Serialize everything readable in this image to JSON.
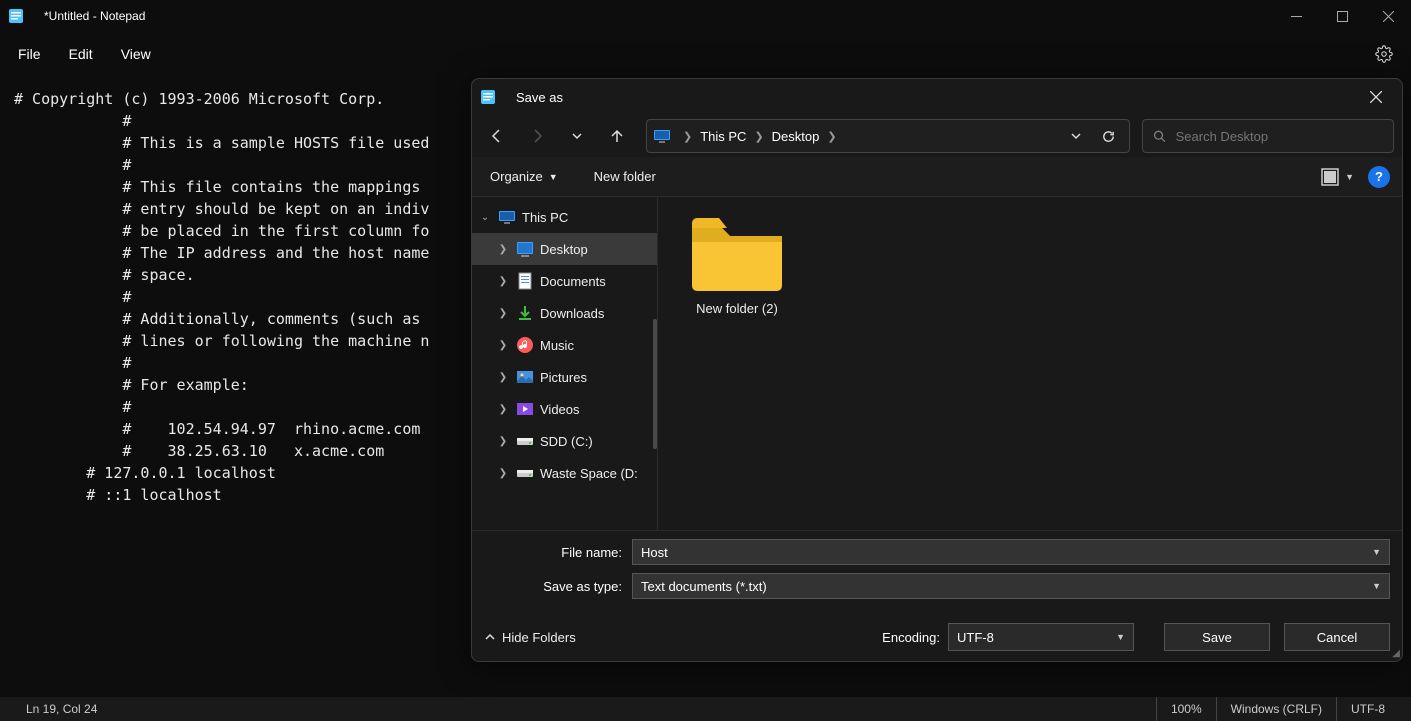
{
  "window": {
    "title": "*Untitled - Notepad"
  },
  "menu": {
    "file": "File",
    "edit": "Edit",
    "view": "View"
  },
  "editor_text": "# Copyright (c) 1993-2006 Microsoft Corp.\n            #\n            # This is a sample HOSTS file used\n            #\n            # This file contains the mappings \n            # entry should be kept on an indiv\n            # be placed in the first column fo\n            # The IP address and the host name\n            # space.\n            #\n            # Additionally, comments (such as \n            # lines or following the machine n\n            #\n            # For example:\n            #\n            #    102.54.94.97  rhino.acme.com \n            #    38.25.63.10   x.acme.com     \n        # 127.0.0.1 localhost\n        # ::1 localhost",
  "status": {
    "pos": "Ln 19, Col 24",
    "zoom": "100%",
    "eol": "Windows (CRLF)",
    "encoding": "UTF-8"
  },
  "dialog": {
    "title": "Save as",
    "path": {
      "root": "This PC",
      "current": "Desktop"
    },
    "search_placeholder": "Search Desktop",
    "toolbar": {
      "organize": "Organize",
      "new_folder": "New folder"
    },
    "tree": [
      {
        "label": "This PC",
        "indent": 0,
        "expanded": true,
        "icon": "pc"
      },
      {
        "label": "Desktop",
        "indent": 1,
        "selected": true,
        "icon": "desktop"
      },
      {
        "label": "Documents",
        "indent": 1,
        "icon": "doc"
      },
      {
        "label": "Downloads",
        "indent": 1,
        "icon": "download"
      },
      {
        "label": "Music",
        "indent": 1,
        "icon": "music"
      },
      {
        "label": "Pictures",
        "indent": 1,
        "icon": "pictures"
      },
      {
        "label": "Videos",
        "indent": 1,
        "icon": "videos"
      },
      {
        "label": "SDD (C:)",
        "indent": 1,
        "icon": "drive"
      },
      {
        "label": "Waste Space (D:",
        "indent": 1,
        "icon": "drive"
      }
    ],
    "items": [
      {
        "label": "New folder (2)"
      }
    ],
    "fields": {
      "name_label": "File name:",
      "name_value": "Host",
      "type_label": "Save as type:",
      "type_value": "Text documents (*.txt)"
    },
    "footer": {
      "hide": "Hide Folders",
      "enc_label": "Encoding:",
      "enc_value": "UTF-8",
      "save": "Save",
      "cancel": "Cancel"
    }
  }
}
